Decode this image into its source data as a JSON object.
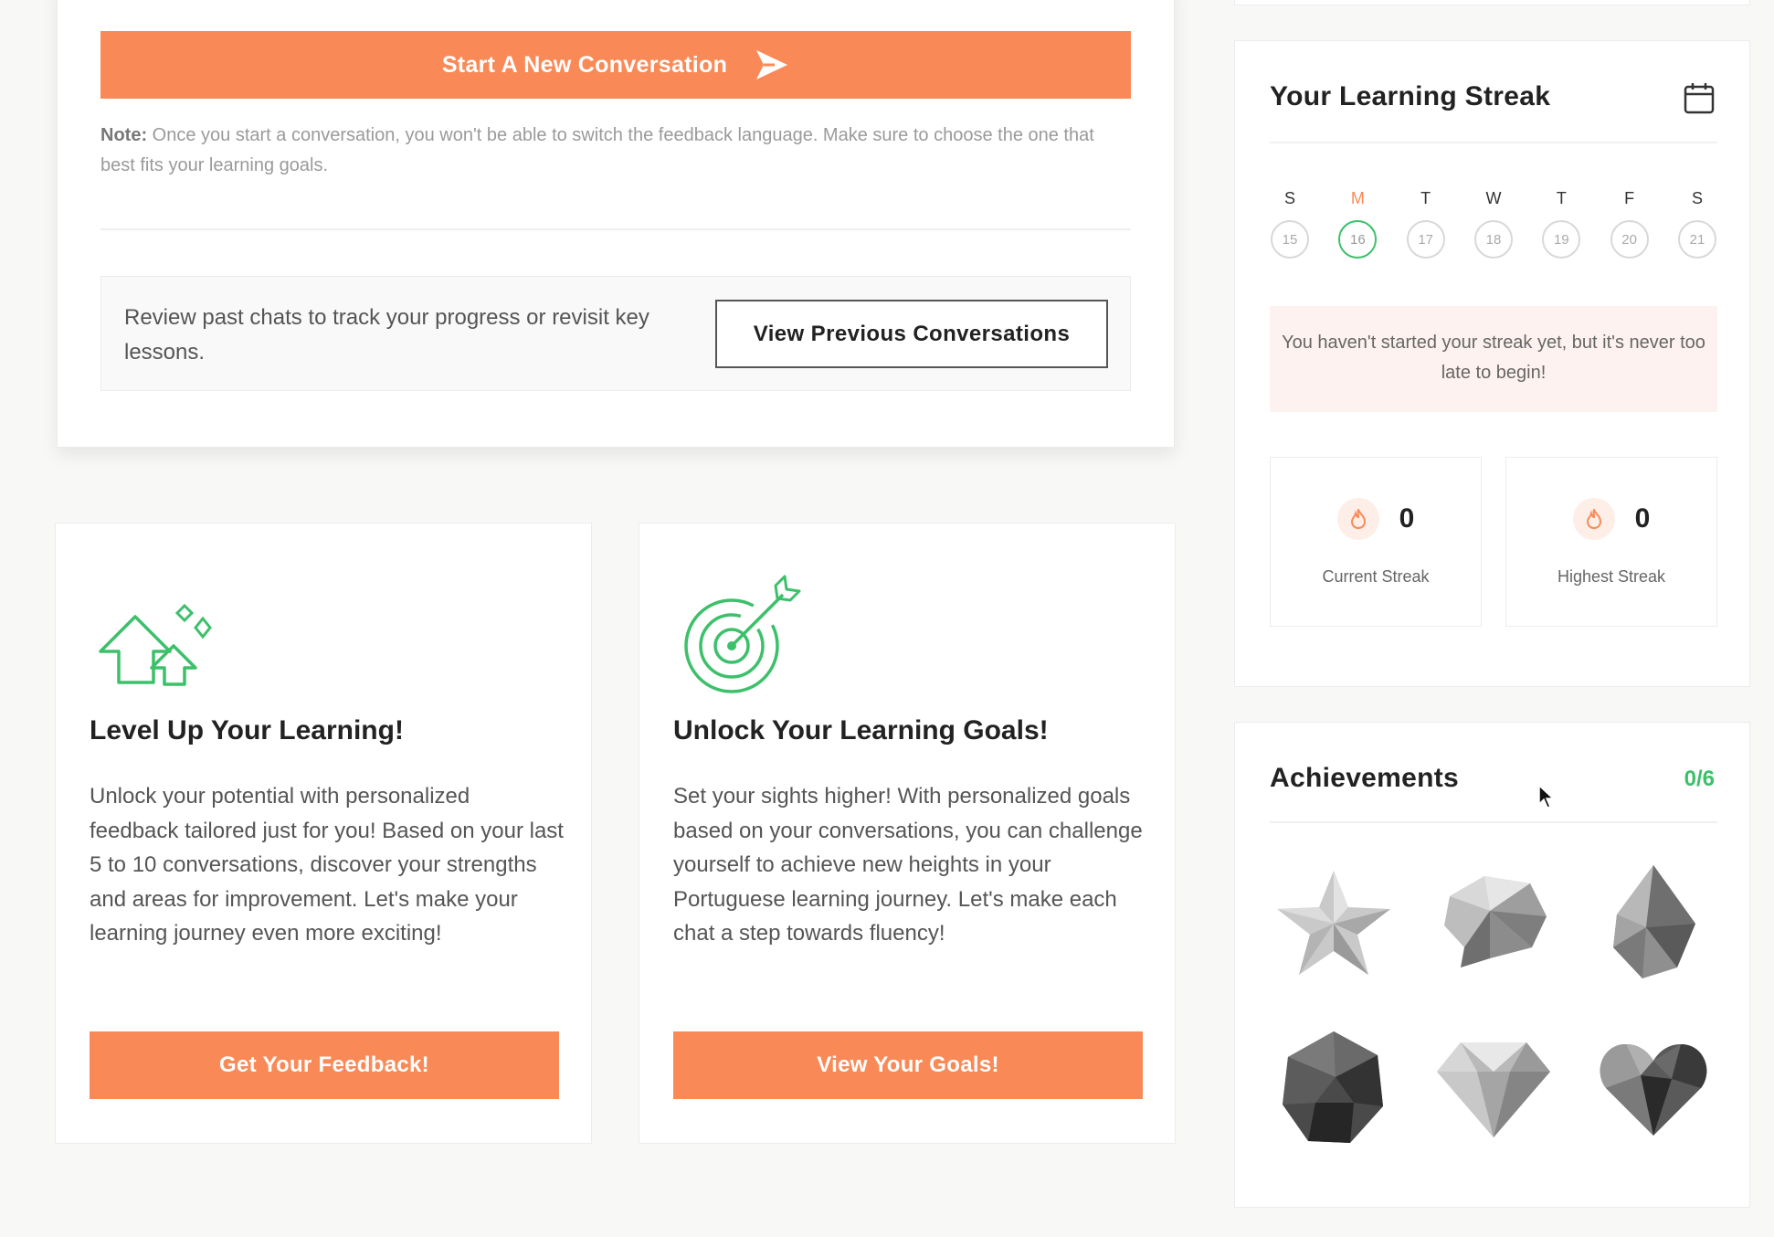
{
  "conversation": {
    "start_button_label": "Start A New Conversation",
    "note_label": "Note:",
    "note_text": " Once you start a conversation, you won't be able to switch the feedback language. Make sure to choose the one that best fits your learning goals.",
    "review_text": "Review past chats to track your progress or revisit key lessons.",
    "view_previous_label": "View Previous Conversations"
  },
  "features": [
    {
      "icon": "level-up-arrows-icon",
      "title": "Level Up Your Learning!",
      "description": "Unlock your potential with personalized feedback tailored just for you! Based on your last 5 to 10 conversations, discover your strengths and areas for improvement. Let's make your learning journey even more exciting!",
      "button_label": "Get Your Feedback!"
    },
    {
      "icon": "target-arrow-icon",
      "title": "Unlock Your Learning Goals!",
      "description": "Set your sights higher! With personalized goals based on your conversations, you can challenge yourself to achieve new heights in your Portuguese learning journey. Let's make each chat a step towards fluency!",
      "button_label": "View Your Goals!"
    }
  ],
  "streak": {
    "title": "Your Learning Streak",
    "days": [
      {
        "letter": "S",
        "num": "15",
        "today": false
      },
      {
        "letter": "M",
        "num": "16",
        "today": true
      },
      {
        "letter": "T",
        "num": "17",
        "today": false
      },
      {
        "letter": "W",
        "num": "18",
        "today": false
      },
      {
        "letter": "T",
        "num": "19",
        "today": false
      },
      {
        "letter": "F",
        "num": "20",
        "today": false
      },
      {
        "letter": "S",
        "num": "21",
        "today": false
      }
    ],
    "message": "You haven't started your streak yet, but it's never too late to begin!",
    "current_value": "0",
    "current_label": "Current Streak",
    "highest_value": "0",
    "highest_label": "Highest Streak"
  },
  "achievements": {
    "title": "Achievements",
    "count": "0/6",
    "badges": [
      "star-badge-icon",
      "chat-bubble-badge-icon",
      "crystal-badge-icon",
      "dodecahedron-badge-icon",
      "diamond-badge-icon",
      "heart-badge-icon"
    ]
  },
  "colors": {
    "accent_orange": "#f98a57",
    "accent_green": "#3cc06a",
    "streak_bg": "#fdf2ef"
  }
}
